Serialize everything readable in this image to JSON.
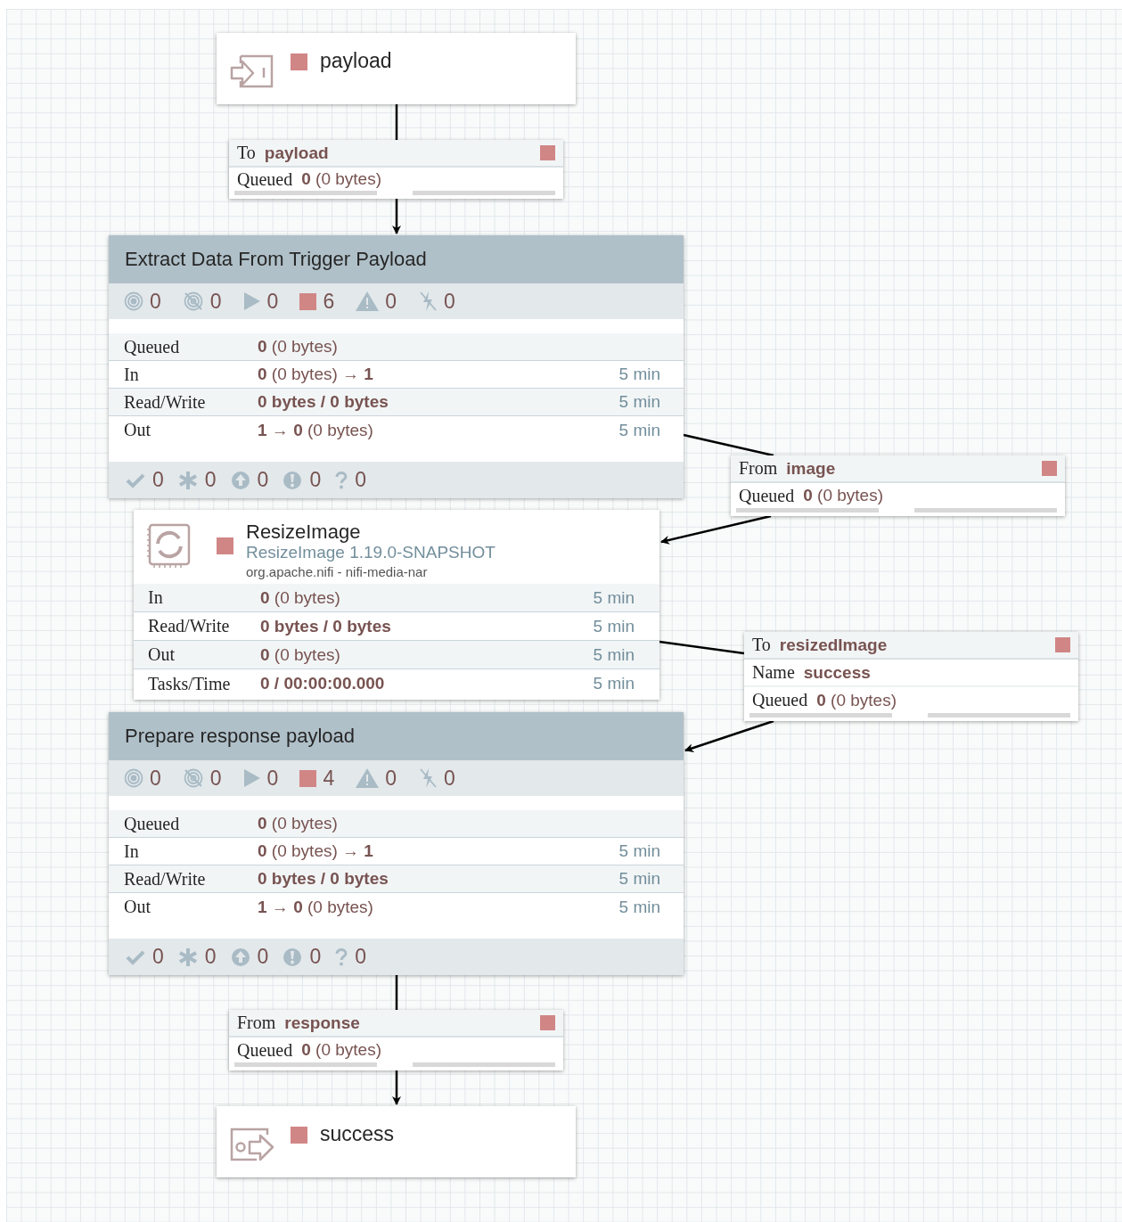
{
  "canvas": {
    "components": [
      {
        "kind": "input_port",
        "name": "payload",
        "stopped": true
      },
      {
        "kind": "connection",
        "stopped": true,
        "rows": [
          {
            "label": "To",
            "value": "payload"
          }
        ],
        "queued": {
          "label": "Queued",
          "value": "**0** (0 bytes)"
        },
        "bars": [
          {
            "level": 0
          },
          {
            "level": 0
          }
        ]
      },
      {
        "kind": "process_group",
        "name": "Extract Data From Trigger Payload",
        "status": [
          {
            "kind": "transmitting",
            "count": "0"
          },
          {
            "kind": "not_transmitting",
            "count": "0"
          },
          {
            "kind": "running",
            "count": "0"
          },
          {
            "kind": "stopped",
            "count": "6"
          },
          {
            "kind": "invalid",
            "count": "0"
          },
          {
            "kind": "disabled",
            "count": "0"
          }
        ],
        "stats": [
          {
            "label": "Queued",
            "value": "**0** (0 bytes)"
          },
          {
            "label": "In",
            "value": "**0** (0 bytes) → **1**",
            "window": "5 min"
          },
          {
            "label": "Read/Write",
            "value": "**0 bytes / 0 bytes**",
            "window": "5 min"
          },
          {
            "label": "Out",
            "value": "**1** → **0** (0 bytes)",
            "window": "5 min"
          }
        ],
        "versioning": [
          {
            "kind": "up_to_date",
            "count": "0"
          },
          {
            "kind": "locally_modified",
            "count": "0"
          },
          {
            "kind": "stale",
            "count": "0"
          },
          {
            "kind": "modified_stale",
            "count": "0"
          },
          {
            "kind": "sync_failure",
            "count": "0"
          }
        ]
      },
      {
        "kind": "connection",
        "stopped": true,
        "rows": [
          {
            "label": "From",
            "value": "image"
          }
        ],
        "queued": {
          "label": "Queued",
          "value": "**0** (0 bytes)"
        },
        "bars": [
          {
            "level": 0
          },
          {
            "level": 0
          }
        ]
      },
      {
        "kind": "processor",
        "name": "ResizeImage",
        "type": "ResizeImage 1.19.0-SNAPSHOT",
        "bundle": "org.apache.nifi - nifi-media-nar",
        "stopped": true,
        "stats": [
          {
            "label": "In",
            "value": "**0** (0 bytes)",
            "window": "5 min"
          },
          {
            "label": "Read/Write",
            "value": "**0 bytes / 0 bytes**",
            "window": "5 min"
          },
          {
            "label": "Out",
            "value": "**0** (0 bytes)",
            "window": "5 min"
          },
          {
            "label": "Tasks/Time",
            "value": "**0 / 00:00:00.000**",
            "window": "5 min"
          }
        ]
      },
      {
        "kind": "connection",
        "stopped": true,
        "rows": [
          {
            "label": "To",
            "value": "resizedImage"
          },
          {
            "label": "Name",
            "value": "success"
          }
        ],
        "queued": {
          "label": "Queued",
          "value": "**0** (0 bytes)"
        },
        "bars": [
          {
            "level": 0
          },
          {
            "level": 0
          }
        ]
      },
      {
        "kind": "process_group",
        "name": "Prepare response payload",
        "status": [
          {
            "kind": "transmitting",
            "count": "0"
          },
          {
            "kind": "not_transmitting",
            "count": "0"
          },
          {
            "kind": "running",
            "count": "0"
          },
          {
            "kind": "stopped",
            "count": "4"
          },
          {
            "kind": "invalid",
            "count": "0"
          },
          {
            "kind": "disabled",
            "count": "0"
          }
        ],
        "stats": [
          {
            "label": "Queued",
            "value": "**0** (0 bytes)"
          },
          {
            "label": "In",
            "value": "**0** (0 bytes) → **1**",
            "window": "5 min"
          },
          {
            "label": "Read/Write",
            "value": "**0 bytes / 0 bytes**",
            "window": "5 min"
          },
          {
            "label": "Out",
            "value": "**1** → **0** (0 bytes)",
            "window": "5 min"
          }
        ],
        "versioning": [
          {
            "kind": "up_to_date",
            "count": "0"
          },
          {
            "kind": "locally_modified",
            "count": "0"
          },
          {
            "kind": "stale",
            "count": "0"
          },
          {
            "kind": "modified_stale",
            "count": "0"
          },
          {
            "kind": "sync_failure",
            "count": "0"
          }
        ]
      },
      {
        "kind": "connection",
        "stopped": true,
        "rows": [
          {
            "label": "From",
            "value": "response"
          }
        ],
        "queued": {
          "label": "Queued",
          "value": "**0** (0 bytes)"
        },
        "bars": [
          {
            "level": 0
          },
          {
            "level": 0
          }
        ]
      },
      {
        "kind": "output_port",
        "name": "success",
        "stopped": true
      }
    ]
  }
}
